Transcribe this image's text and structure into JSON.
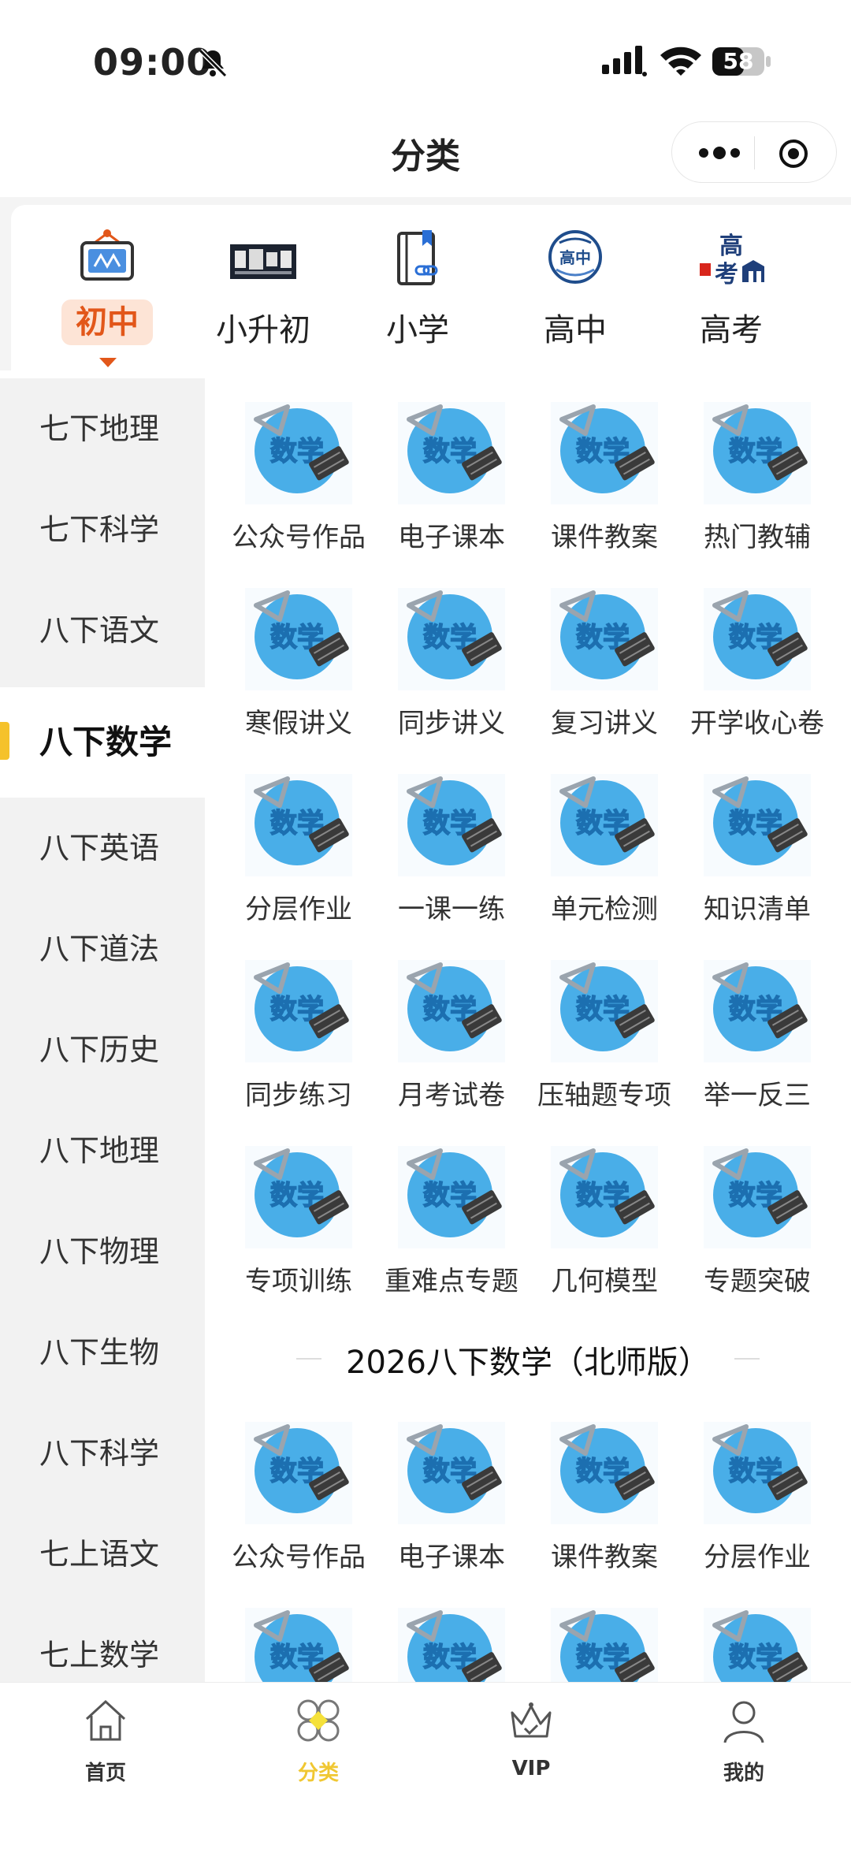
{
  "status": {
    "time": "09:00",
    "battery": "58"
  },
  "navbar": {
    "title": "分类"
  },
  "levels": [
    {
      "label": "初中",
      "icon": "monitor-icon",
      "active": true
    },
    {
      "label": "小升初",
      "icon": "poster-icon",
      "active": false
    },
    {
      "label": "小学",
      "icon": "book-link-icon",
      "active": false
    },
    {
      "label": "高中",
      "icon": "high-school-badge-icon",
      "active": false
    },
    {
      "label": "高考",
      "icon": "gaokao-icon",
      "active": false
    }
  ],
  "level_icon_texts": {
    "high_school": "高中",
    "gaokao_top": "高",
    "gaokao_bottom": "考"
  },
  "sidebar": [
    {
      "label": "七下地理"
    },
    {
      "label": "七下科学"
    },
    {
      "label": "八下语文"
    },
    {
      "label": "八下数学",
      "active": true
    },
    {
      "label": "八下英语"
    },
    {
      "label": "八下道法"
    },
    {
      "label": "八下历史"
    },
    {
      "label": "八下地理"
    },
    {
      "label": "八下物理"
    },
    {
      "label": "八下生物"
    },
    {
      "label": "八下科学"
    },
    {
      "label": "七上语文"
    },
    {
      "label": "七上数学"
    }
  ],
  "thumb_text": "数学",
  "grid1": [
    "公众号作品",
    "电子课本",
    "课件教案",
    "热门教辅",
    "寒假讲义",
    "同步讲义",
    "复习讲义",
    "开学收心卷",
    "分层作业",
    "一课一练",
    "单元检测",
    "知识清单",
    "同步练习",
    "月考试卷",
    "压轴题专项",
    "举一反三",
    "专项训练",
    "重难点专题",
    "几何模型",
    "专题突破"
  ],
  "section_title": "2026八下数学（北师版）",
  "grid2": [
    "公众号作品",
    "电子课本",
    "课件教案",
    "分层作业",
    "",
    "",
    "",
    ""
  ],
  "tabbar": [
    {
      "label": "首页",
      "icon": "home-icon"
    },
    {
      "label": "分类",
      "icon": "category-icon",
      "active": true
    },
    {
      "label": "VIP",
      "icon": "crown-icon"
    },
    {
      "label": "我的",
      "icon": "profile-icon"
    }
  ],
  "colors": {
    "accent": "#e2571a",
    "tab_active": "#f0c732",
    "sidebar_marker": "#f5c22b",
    "thumb_blue": "#49aee8"
  }
}
